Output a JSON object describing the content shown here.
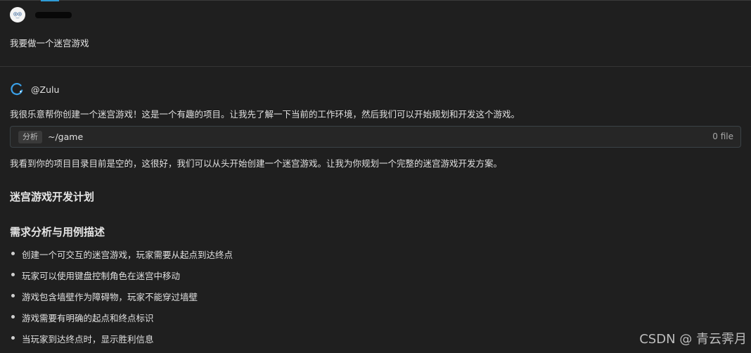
{
  "user": {
    "avatar_icon": "user-avatar-icon",
    "message": "我要做一个迷宫游戏"
  },
  "agent": {
    "logo_icon": "zulu-logo-icon",
    "name": "@Zulu",
    "intro": "我很乐意帮你创建一个迷宫游戏！这是一个有趣的项目。让我先了解一下当前的工作环境，然后我们可以开始规划和开发这个游戏。",
    "tool_call": {
      "tag": "分析",
      "path": "~/game",
      "count": "0 file"
    },
    "followup": "我看到你的项目目录目前是空的，这很好，我们可以从头开始创建一个迷宫游戏。让我为你规划一个完整的迷宫游戏开发方案。",
    "plan_title": "迷宫游戏开发计划",
    "section_title": "需求分析与用例描述",
    "requirements": [
      "创建一个可交互的迷宫游戏，玩家需要从起点到达终点",
      "玩家可以使用键盘控制角色在迷宫中移动",
      "游戏包含墙壁作为障碍物，玩家不能穿过墙壁",
      "游戏需要有明确的起点和终点标识",
      "当玩家到达终点时，显示胜利信息"
    ]
  },
  "watermark": "CSDN @ 青云霁月",
  "colors": {
    "background": "#1f1f1f",
    "accent": "#2f9bd6",
    "card_border": "#3a4246"
  }
}
